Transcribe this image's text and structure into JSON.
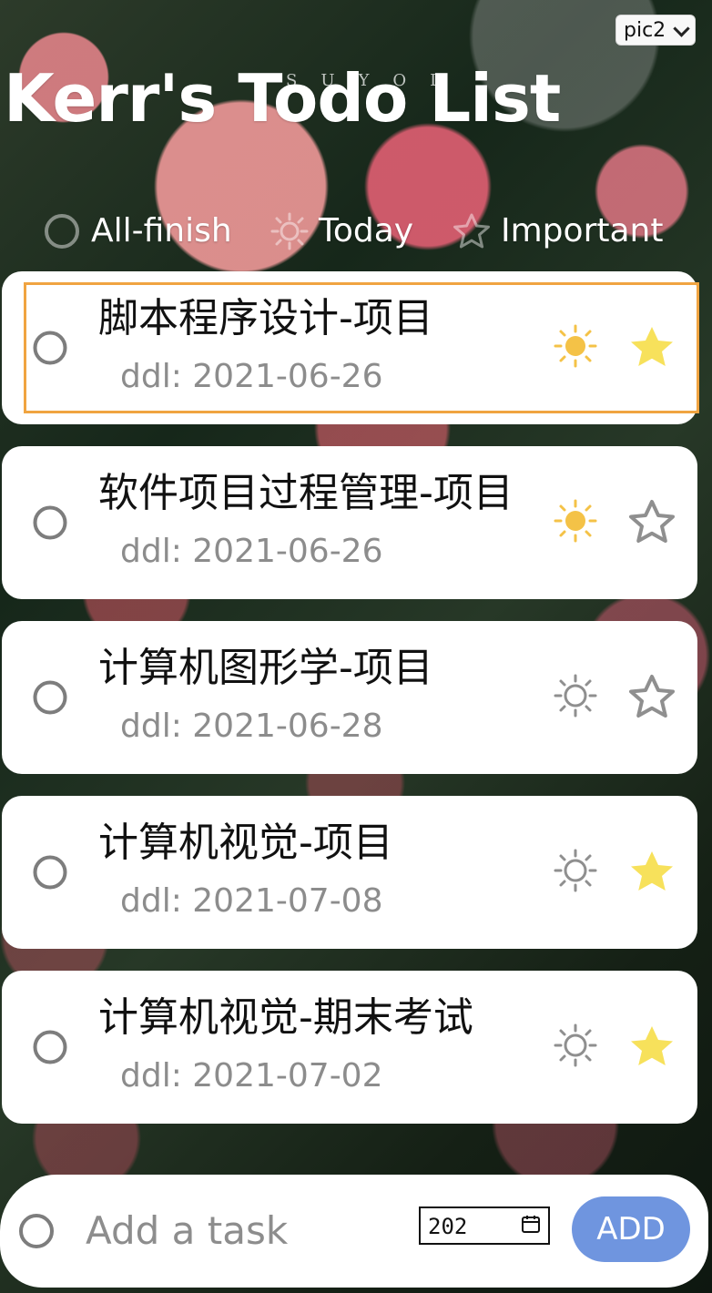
{
  "header": {
    "theme_selector_value": "pic2",
    "title": "Kerr's Todo List",
    "watermark": "SUYOL"
  },
  "tabs": [
    {
      "label": "All-finish",
      "icon": "circle-icon"
    },
    {
      "label": "Today",
      "icon": "sun-icon"
    },
    {
      "label": "Important",
      "icon": "star-icon"
    }
  ],
  "tasks": [
    {
      "title": "脚本程序设计-项目",
      "ddl": "ddl: 2021-06-26",
      "today": true,
      "important": true,
      "selected": true
    },
    {
      "title": "软件项目过程管理-项目",
      "ddl": "ddl: 2021-06-26",
      "today": true,
      "important": false,
      "selected": false
    },
    {
      "title": "计算机图形学-项目",
      "ddl": "ddl: 2021-06-28",
      "today": false,
      "important": false,
      "selected": false
    },
    {
      "title": "计算机视觉-项目",
      "ddl": "ddl: 2021-07-08",
      "today": false,
      "important": true,
      "selected": false
    },
    {
      "title": "计算机视觉-期末考试",
      "ddl": "ddl: 2021-07-02",
      "today": false,
      "important": true,
      "selected": false
    }
  ],
  "composer": {
    "placeholder": "Add a task",
    "date_value": "202",
    "add_label": "ADD"
  },
  "colors": {
    "selection_outline": "#f0a441",
    "today_active": "#f4c247",
    "today_inactive": "#8f8f8f",
    "important_active": "#f7e15b",
    "important_inactive": "#8f8f8f",
    "add_button": "#6f95df"
  }
}
